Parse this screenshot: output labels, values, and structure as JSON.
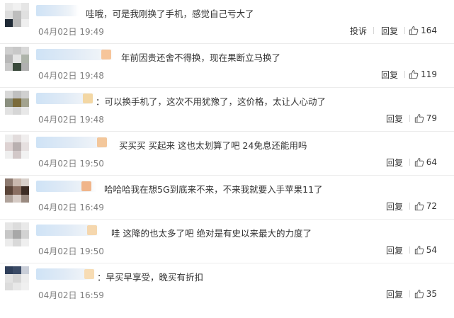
{
  "labels": {
    "report": "投诉",
    "reply": "回复"
  },
  "comments": [
    {
      "text": "哇哦，可是我刚换了手机，感觉自己亏大了",
      "time": "04月02日 19:49",
      "likes": "164",
      "has_report": true
    },
    {
      "text": "年前因贵还舍不得换，现在果断立马换了",
      "time": "04月02日 19:48",
      "likes": "119",
      "has_report": false
    },
    {
      "text": "：可以换手机了，这次不用犹豫了，这价格，太让人心动了",
      "time": "04月02日 19:48",
      "likes": "79",
      "has_report": false
    },
    {
      "text": "买买买 买起来 这也太划算了吧 24免息还能用吗",
      "time": "04月02日 19:50",
      "likes": "64",
      "has_report": false
    },
    {
      "text": "哈哈哈我在想5G到底来不来，不来我就要入手苹果11了",
      "time": "04月02日 16:49",
      "likes": "72",
      "has_report": false
    },
    {
      "text": "哇 这降的也太多了吧 绝对是有史以来最大的力度了",
      "time": "04月02日 19:50",
      "likes": "54",
      "has_report": false
    },
    {
      "text": "：早买早享受，晚买有折扣",
      "time": "04月02日 16:59",
      "likes": "35",
      "has_report": false
    }
  ]
}
